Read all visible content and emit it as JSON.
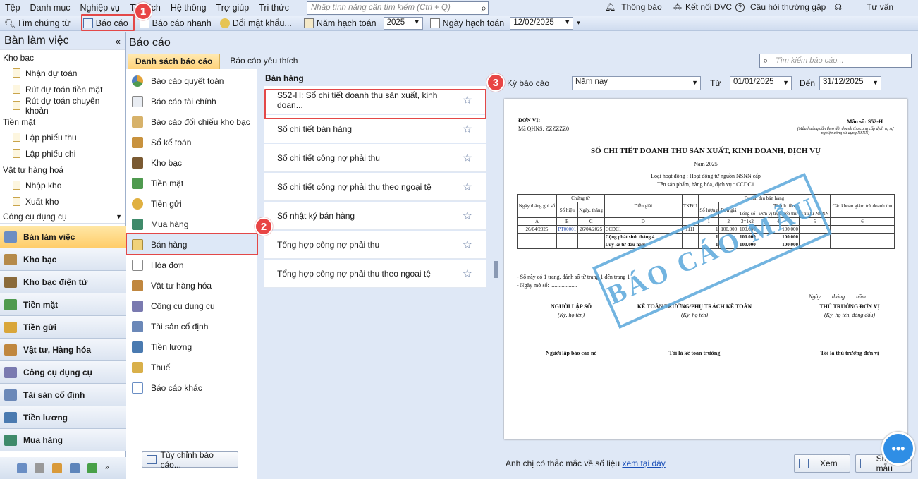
{
  "menu": [
    "Tệp",
    "Danh mục",
    "Nghiệp vụ",
    "Tiện ích",
    "Hệ thống",
    "Trợ giúp",
    "Tri thức"
  ],
  "search_placeholder": "Nhập tính năng cần tìm kiếm (Ctrl + Q)",
  "topright": {
    "notify": "Thông báo",
    "dvc": "Kết nối DVC",
    "faq": "Câu hỏi thường gặp",
    "advise": "Tư vấn"
  },
  "toolbar": {
    "find": "Tìm chứng từ",
    "report": "Báo cáo",
    "quick": "Báo cáo nhanh",
    "pwd": "Đổi mật khẩu...",
    "year_label": "Năm hạch toán",
    "year": "2025",
    "date_label": "Ngày hạch toán",
    "date": "12/02/2025"
  },
  "badges": [
    "1",
    "2",
    "3"
  ],
  "left": {
    "title": "Bàn làm việc",
    "groups": [
      {
        "name": "Kho bạc",
        "items": [
          "Nhận dự toán",
          "Rút dự toán tiền mặt",
          "Rút dự toán chuyển khoản"
        ]
      },
      {
        "name": "Tiền mặt",
        "items": [
          "Lập phiếu thu",
          "Lập phiếu chi"
        ]
      },
      {
        "name": "Vật tư hàng hoá",
        "items": [
          "Nhập kho",
          "Xuất kho"
        ]
      }
    ],
    "dropdown": "Công cụ dụng cụ",
    "nav": [
      "Bàn làm việc",
      "Kho bạc",
      "Kho bạc điện tử",
      "Tiền mặt",
      "Tiền gửi",
      "Vật tư, Hàng hóa",
      "Công cụ dụng cụ",
      "Tài sản cố định",
      "Tiền lương",
      "Mua hàng"
    ]
  },
  "main": {
    "title": "Báo cáo",
    "tabs": [
      "Danh sách báo cáo",
      "Báo cáo yêu thích"
    ],
    "search_placeholder": "Tìm kiếm báo cáo..."
  },
  "categories": [
    "Báo cáo quyết toán",
    "Báo cáo tài chính",
    "Báo cáo đối chiếu kho bạc",
    "Sổ kế toán",
    "Kho bạc",
    "Tiền mặt",
    "Tiền gửi",
    "Mua hàng",
    "Bán hàng",
    "Hóa đơn",
    "Vật tư hàng hóa",
    "Công cụ dụng cụ",
    "Tài sản cố định",
    "Tiền lương",
    "Thuế",
    "Báo cáo khác"
  ],
  "customize": "Tùy chỉnh báo cáo...",
  "reports": {
    "heading": "Bán hàng",
    "items": [
      "S52-H: Sổ chi tiết doanh thu sản xuất, kinh doan...",
      "Sổ chi tiết bán hàng",
      "Sổ chi tiết công nợ phải thu",
      "Sổ chi tiết công nợ phải thu theo ngoại tệ",
      "Sổ nhật ký bán hàng",
      "Tổng hợp công nợ phải thu",
      "Tổng hợp công nợ phải thu theo ngoại tệ"
    ]
  },
  "period": {
    "label": "Kỳ báo cáo",
    "value": "Năm nay",
    "from_label": "Từ",
    "from": "01/01/2025",
    "to_label": "Đến",
    "to": "31/12/2025"
  },
  "paper": {
    "unit": "ĐƠN VỊ:",
    "qhns": "Mã QHNS: ZZZZZZ0",
    "form": "Mẫu số: S52-H",
    "form_note": "(Mẫu hướng dẫn theo dõi doanh thu cung cấp dịch vụ sự nghiệp công sử dụng NSNN)",
    "title": "SỔ CHI TIẾT DOANH THU SẢN XUẤT, KINH DOANH, DỊCH VỤ",
    "year": "Năm 2025",
    "activity": "Loại hoạt động : Hoạt động từ nguồn NSNN cấp",
    "product": "Tên sản phẩm, hàng hóa, dịch vụ : CCDC1",
    "h": [
      "Ngày tháng ghi sổ",
      "Chứng từ",
      "Số hiệu",
      "Ngày, tháng",
      "Diễn giải",
      "TKĐU",
      "Doanh thu bán hàng",
      "Số lượng",
      "Đơn giá",
      "Thành tiền",
      "Tổng số",
      "Đơn vị trực tiếp thu",
      "Thu từ NSNN",
      "Các khoản giảm trừ doanh thu"
    ],
    "codes": [
      "A",
      "B",
      "C",
      "D",
      "",
      "1",
      "2",
      "3=1x2",
      "4",
      "5",
      "6"
    ],
    "row1": [
      "26/04/2025",
      "PT00001",
      "26/04/2025",
      "CCDC1",
      "1111",
      "1",
      "100.000",
      "100.000",
      "100.000"
    ],
    "row2": [
      "Cộng phát sinh tháng 4",
      "1",
      "",
      "100.000",
      "100.000"
    ],
    "row3": [
      "Lũy kế từ đầu năm",
      "1",
      "",
      "100.000",
      "100.000"
    ],
    "note1": "- Sổ này có 1 trang, đánh số từ trang 1 đến trang 1",
    "note2": "- Ngày mở sổ: ...................",
    "date_line": "Ngày ...... tháng ...... năm ........",
    "sig1": "NGƯỜI LẬP SỔ",
    "sig2": "KẾ TOÁN TRƯỞNG/PHỤ TRÁCH KẾ TOÁN",
    "sig3": "THỦ TRƯỞNG ĐƠN VỊ",
    "sig1n": "(Ký, họ tên)",
    "sig2n": "(Ký, họ tên)",
    "sig3n": "(Ký, họ tên, đóng dấu)",
    "name1": "Người lập báo cáo nè",
    "name2": "Tôi là kế toán trưởng",
    "name3": "Tôi là thủ trưởng đơn vị",
    "stamp": "BÁO CÁO MẪU"
  },
  "bottom": {
    "question": "Anh chị có thắc mắc về số liệu",
    "link": "xem tại đây",
    "view": "Xem",
    "edit": "Sửa mẫu"
  }
}
